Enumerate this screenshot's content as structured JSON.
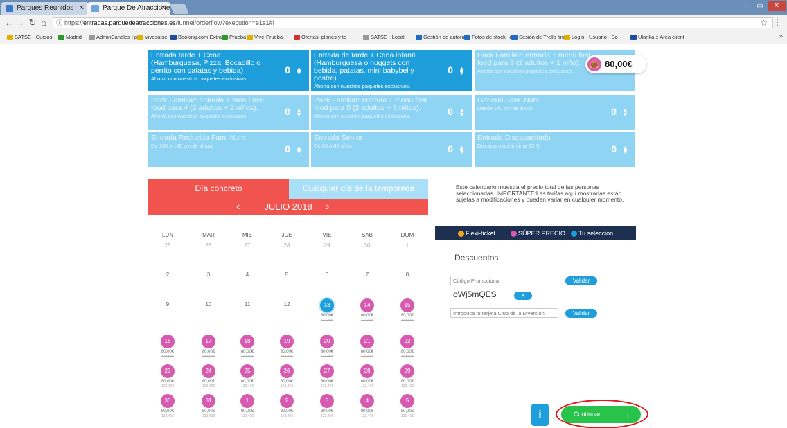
{
  "browser": {
    "tabs": [
      {
        "title": "Parques Reunidos",
        "favicon_color": "#3a78c8"
      },
      {
        "title": "Parque De Atracciones d",
        "favicon_color": "#6fa4d8"
      }
    ],
    "url_prefix": "https://",
    "url_host": "entradas.parquedeatracciones.es",
    "url_path": "/funnel/orderflow?execution=e1s1#!",
    "bookmarks": [
      {
        "label": "SATSE - Cursos",
        "color": "#e0b000"
      },
      {
        "label": "Madrid",
        "color": "#2a9a2a"
      },
      {
        "label": "AdminCanales | pop",
        "color": "#999999"
      },
      {
        "label": "Vivesatse",
        "color": "#e0b000"
      },
      {
        "label": "Booking.com Extran",
        "color": "#1f4e9c"
      },
      {
        "label": "Prueba",
        "color": "#2a9a2a"
      },
      {
        "label": "Vive-Prueba",
        "color": "#e0b000"
      },
      {
        "label": "Ofertas, planes y to",
        "color": "#cc3333"
      },
      {
        "label": "SATSE - Local",
        "color": "#999999"
      },
      {
        "label": "Gestión de autoriza",
        "color": "#1f6cc0"
      },
      {
        "label": "Fotos de stock, imá",
        "color": "#1f6cc0"
      },
      {
        "label": "Sesión de Trello fina",
        "color": "#1f6cc0"
      },
      {
        "label": "Login - Usuario - So",
        "color": "#e0b000"
      },
      {
        "label": "Ulanka :: Area client",
        "color": "#1f4e9c"
      }
    ]
  },
  "tickets": [
    {
      "title": "Entrada tarde + Cena (Hamburguesa, Pizza, Bocadillo o perrito con patatas y bebida)",
      "sub": "Ahorra con nuestros paquetes exclusivos.",
      "qty": "0",
      "style": "dark"
    },
    {
      "title": "Entrada de tarde + Cena infantil (Hamburguesa o nuggets con bebida, patatas, mini babybel y postre)",
      "sub": "Ahorra con nuestros paquetes exclusivos.",
      "qty": "0",
      "style": "dark"
    },
    {
      "title": "Pack Familiar: entrada + menú fast food para 3 (2 adultos + 1 niño).",
      "sub": "Ahorra con nuestros paquetes exclusivos.",
      "qty": "",
      "style": "light"
    },
    {
      "title": "Pack Familiar: entrada + menú fast food para 4 (2 adultos + 2 niños).",
      "sub": "Ahorra con nuestros paquetes exclusivos.",
      "qty": "0",
      "style": "light"
    },
    {
      "title": "Pack Familiar: entrada + menú fast food para 5 (2 adultos + 3 niños).",
      "sub": "Ahorra con nuestros paquetes exclusivos.",
      "qty": "0",
      "style": "light"
    },
    {
      "title": "General Fam. Num.",
      "sub": "Desde 140 cm de altura",
      "qty": "0",
      "style": "light"
    },
    {
      "title": "Entrada Reducida Fam. Num",
      "sub": "De 100 a 140 cm de altura",
      "qty": "0",
      "style": "light"
    },
    {
      "title": "Entrada Senior",
      "sub": "De 60 a 65 años",
      "qty": "0",
      "style": "light"
    },
    {
      "title": "Entrada Discapacitado",
      "sub": "Discapacidad mínima 33 %",
      "qty": "0",
      "style": "light"
    }
  ],
  "total_price": "80,00€",
  "calendar": {
    "tab_active": "Día concreto",
    "tab_inactive": "Cualquier día de la temporada",
    "month": "JULIO 2018",
    "weekdays": [
      "LUN",
      "MAR",
      "MIE",
      "JUE",
      "VIE",
      "SAB",
      "DOM"
    ],
    "plain_rows": [
      [
        {
          "d": "25",
          "past": true
        },
        {
          "d": "26",
          "past": true
        },
        {
          "d": "27",
          "past": true
        },
        {
          "d": "28",
          "past": true
        },
        {
          "d": "29",
          "past": true
        },
        {
          "d": "30",
          "past": true
        },
        {
          "d": "1",
          "past": true
        }
      ],
      [
        {
          "d": "2"
        },
        {
          "d": "3"
        },
        {
          "d": "4"
        },
        {
          "d": "5"
        },
        {
          "d": "6"
        },
        {
          "d": "7"
        },
        {
          "d": "8"
        }
      ],
      [
        {
          "d": "9"
        },
        {
          "d": "10"
        },
        {
          "d": "11"
        },
        {
          "d": "12"
        }
      ]
    ],
    "priced_days": [
      {
        "d": "13",
        "selected": true
      },
      {
        "d": "14"
      },
      {
        "d": "15"
      },
      {
        "d": "16"
      },
      {
        "d": "17"
      },
      {
        "d": "18"
      },
      {
        "d": "19"
      },
      {
        "d": "20"
      },
      {
        "d": "21"
      },
      {
        "d": "22"
      },
      {
        "d": "23"
      },
      {
        "d": "24"
      },
      {
        "d": "25"
      },
      {
        "d": "26"
      },
      {
        "d": "27"
      },
      {
        "d": "28"
      },
      {
        "d": "29"
      },
      {
        "d": "30"
      },
      {
        "d": "31"
      },
      {
        "d": "1"
      },
      {
        "d": "2"
      },
      {
        "d": "3"
      },
      {
        "d": "4"
      },
      {
        "d": "5"
      }
    ],
    "day_price": "80,00€",
    "day_old_price": "123,40€",
    "sel_color": "#1e9fdb",
    "super_color": "#d65ab0"
  },
  "info_text": "Este calendario muestra el precio total de las personas seleccionadas. IMPORTANTE:Las tarifas aquí mostradas están sujetas a modificaciones y pueden variar en cualquier momento.",
  "legend": [
    {
      "label": "Flexi-ticket",
      "color": "#f5a623"
    },
    {
      "label": "SÚPER PRECIO",
      "color": "#d65ab0"
    },
    {
      "label": "Tu selección",
      "color": "#1e9fdb"
    }
  ],
  "discounts": {
    "title": "Descuentos",
    "promo_placeholder": "Código Promocional",
    "validate_label": "Validar",
    "applied_code": "oWj5mQES",
    "remove_label": "X",
    "club_placeholder": "Introduca tu tarjeta Club de la Diversión"
  },
  "actions": {
    "info_label": "i",
    "continue_label": "Continuar",
    "continue_arrow": "→"
  }
}
